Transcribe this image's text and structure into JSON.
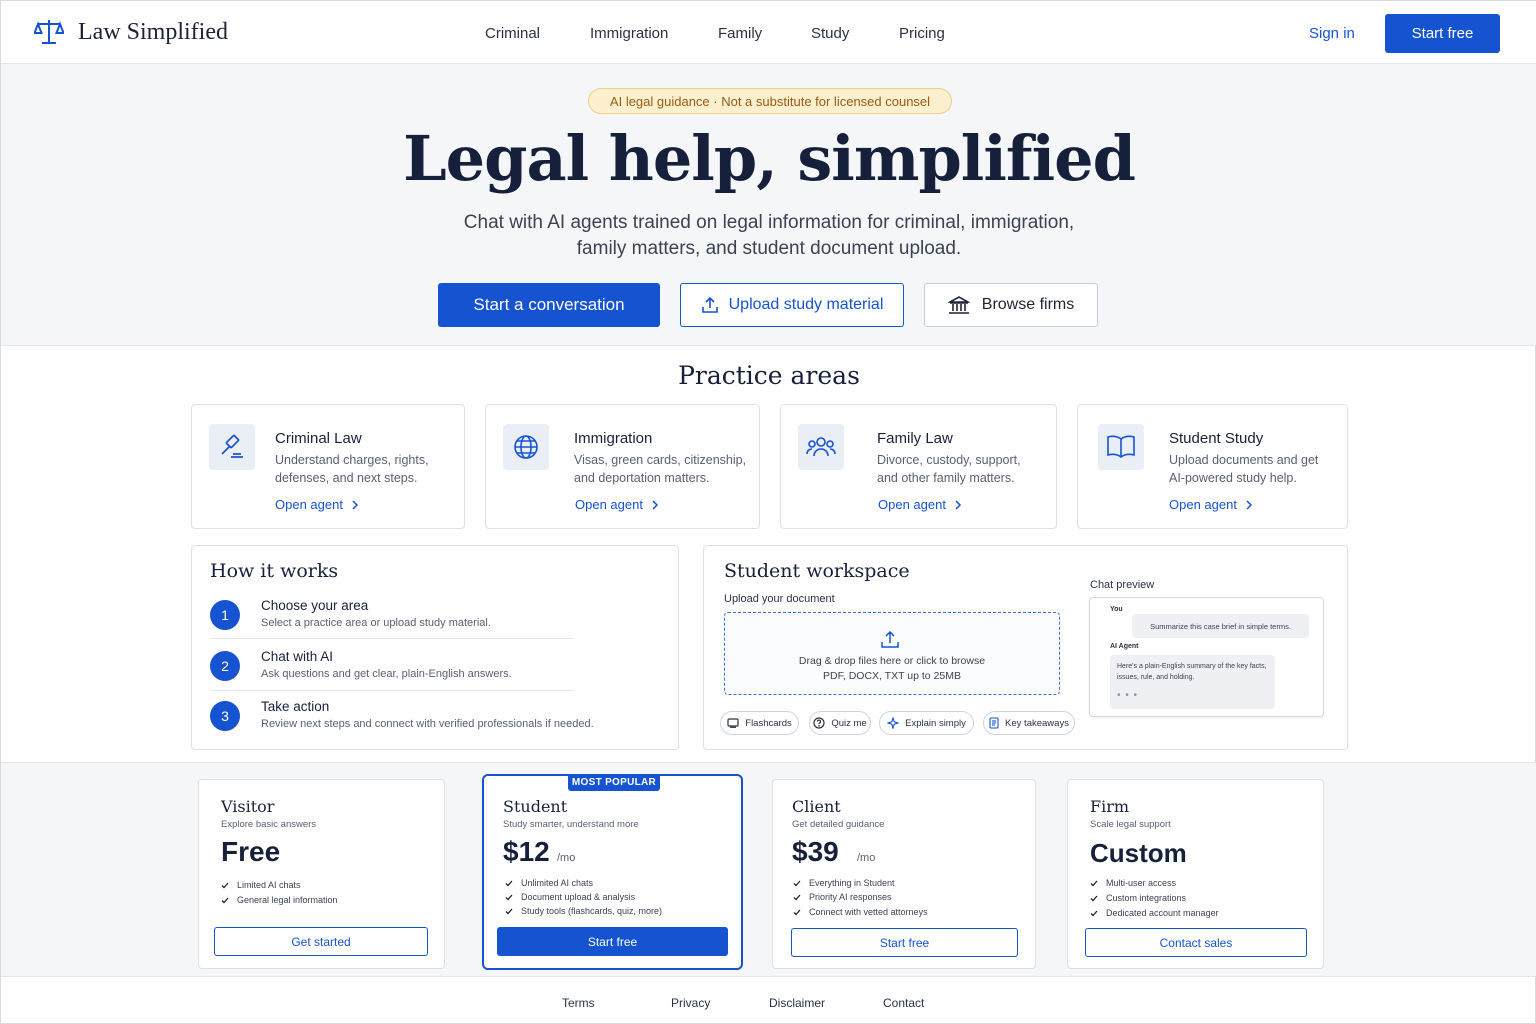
{
  "header": {
    "brand": "Law Simplified",
    "nav": [
      "Criminal",
      "Immigration",
      "Family",
      "Study",
      "Pricing"
    ],
    "sign_in": "Sign in",
    "start_free": "Start free"
  },
  "hero": {
    "notice": "AI legal guidance · Not a substitute for licensed counsel",
    "title": "Legal help, simplified",
    "subtitle_line1": "Chat with AI agents trained on legal information for criminal, immigration,",
    "subtitle_line2": "family matters, and student document upload.",
    "cta_primary": "Start a conversation",
    "cta_upload": "Upload study material",
    "cta_browse": "Browse firms"
  },
  "practice": {
    "title": "Practice areas",
    "cards": [
      {
        "title": "Criminal Law",
        "desc1": "Understand charges, rights,",
        "desc2": "defenses, and next steps.",
        "link": "Open agent",
        "icon": "gavel-icon"
      },
      {
        "title": "Immigration",
        "desc1": "Visas, green cards, citizenship,",
        "desc2": "and deportation matters.",
        "link": "Open agent",
        "icon": "globe-icon"
      },
      {
        "title": "Family Law",
        "desc1": "Divorce, custody, support,",
        "desc2": "and other family matters.",
        "link": "Open agent",
        "icon": "people-icon"
      },
      {
        "title": "Student Study",
        "desc1": "Upload documents and get",
        "desc2": "AI-powered study help.",
        "link": "Open agent",
        "icon": "book-icon"
      }
    ]
  },
  "how": {
    "title": "How it works",
    "steps": [
      {
        "num": "1",
        "title": "Choose your area",
        "desc": "Select a practice area or upload study material."
      },
      {
        "num": "2",
        "title": "Chat with AI",
        "desc": "Ask questions and get clear, plain-English answers."
      },
      {
        "num": "3",
        "title": "Take action",
        "desc": "Review next steps and connect with verified professionals if needed."
      }
    ]
  },
  "workspace": {
    "title": "Student workspace",
    "upload_label": "Upload your document",
    "drop_line1": "Drag & drop files here or click to browse",
    "drop_line2": "PDF, DOCX, TXT up to 25MB",
    "chips": [
      "Flashcards",
      "Quiz me",
      "Explain simply",
      "Key takeaways"
    ],
    "chat": {
      "label": "Chat preview",
      "you": "You",
      "you_msg": "Summarize this case brief in simple terms.",
      "agent": "AI Agent",
      "agent_msg": "Here's a plain-English summary of the key facts, issues, rule, and holding.",
      "typing": "• • •"
    }
  },
  "pricing": {
    "badge": "MOST POPULAR",
    "plans": [
      {
        "name": "Visitor",
        "tagline": "Explore basic answers",
        "price": "Free",
        "per": "",
        "features": [
          "Limited AI chats",
          "General legal information"
        ],
        "button": "Get started"
      },
      {
        "name": "Student",
        "tagline": "Study smarter, understand more",
        "price": "$12",
        "per": "/mo",
        "features": [
          "Unlimited AI chats",
          "Document upload & analysis",
          "Study tools (flashcards, quiz, more)"
        ],
        "button": "Start free"
      },
      {
        "name": "Client",
        "tagline": "Get detailed guidance",
        "price": "$39",
        "per": "/mo",
        "features": [
          "Everything in Student",
          "Priority AI responses",
          "Connect with vetted attorneys"
        ],
        "button": "Start free"
      },
      {
        "name": "Firm",
        "tagline": "Scale legal support",
        "price": "Custom",
        "per": "",
        "features": [
          "Multi-user access",
          "Custom integrations",
          "Dedicated account manager"
        ],
        "button": "Contact sales"
      }
    ]
  },
  "footer": {
    "links": [
      "Terms",
      "Privacy",
      "Disclaimer",
      "Contact"
    ]
  },
  "colors": {
    "primary": "#1553d1",
    "heading": "#17203a",
    "notice_bg": "#fdf0cf",
    "notice_text": "#9a5b14"
  }
}
